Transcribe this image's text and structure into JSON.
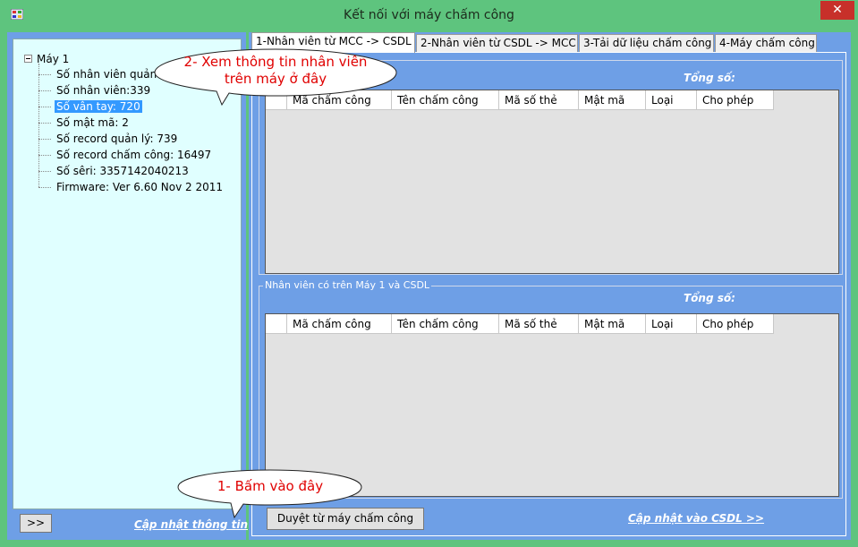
{
  "window": {
    "title": "Kết nối với máy chấm công",
    "close_label": "✕",
    "accent": "#5ec47e",
    "panel_color": "#6e9fe6"
  },
  "tree": {
    "root": "Máy 1",
    "items": [
      "Số nhân viên quản",
      "Số nhân viên:339",
      "Số vân tay: 720",
      "Số mật mã: 2",
      "Số record quản lý: 739",
      "Số record chấm công: 16497",
      "Số sêri: 3357142040213",
      "Firmware: Ver 6.60 Nov  2 2011"
    ],
    "selected_index": 2
  },
  "left_footer": {
    "expand_button": ">>",
    "update_info_link": "Cập nhật thông tin"
  },
  "tabs": [
    "1-Nhân viên từ MCC -> CSDL",
    "2-Nhân viên từ CSDL -> MCC",
    "3-Tải dữ liệu chấm công",
    "4-Máy chấm công"
  ],
  "active_tab": 0,
  "group1": {
    "title": "",
    "total_label": "Tổng số:"
  },
  "group2": {
    "title": "Nhân viên có trên Máy 1 và CSDL",
    "total_label": "Tổng số:"
  },
  "grid_columns": [
    "",
    "Mã chấm công",
    "Tên chấm công",
    "Mã số thẻ",
    "Mật mã",
    "Loại",
    "Cho phép"
  ],
  "footer": {
    "browse_button": "Duyệt từ máy chấm công",
    "update_db_link": "Cập nhật vào CSDL >>"
  },
  "callouts": {
    "top_line1": "2- Xem thông tin nhân viên",
    "top_line2": "trên máy ở đây",
    "bottom": "1- Bấm vào đây",
    "text_color": "#e00000"
  }
}
